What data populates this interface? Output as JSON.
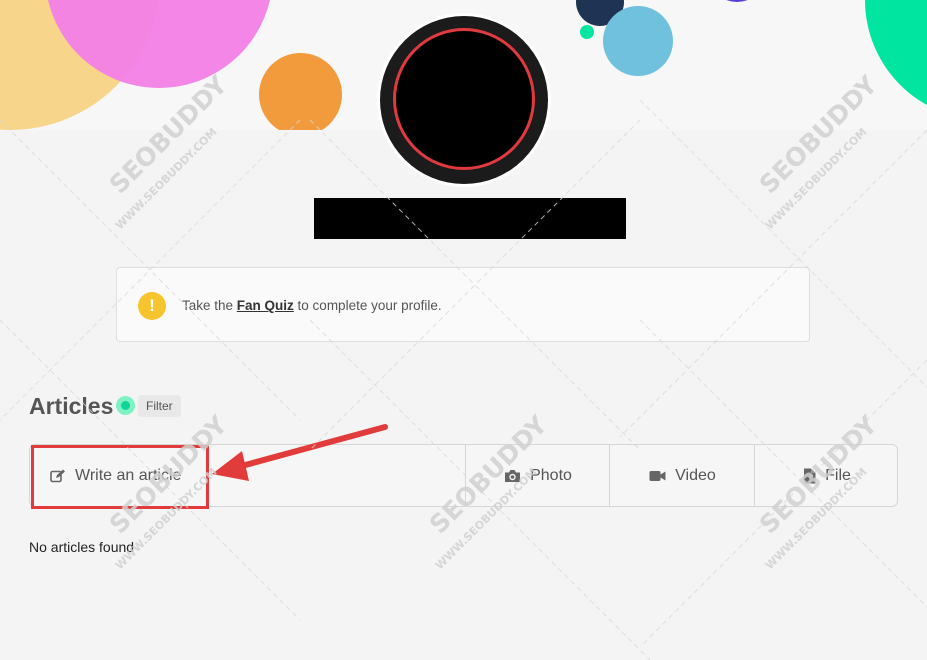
{
  "colors": {
    "background": "#f4f4f4",
    "banner_pink": "#f37fe6",
    "banner_yellow": "#f7d58a",
    "banner_orange": "#f29b3c",
    "banner_blue": "#6fc1de",
    "banner_navy": "#1f3354",
    "banner_green": "#00e5a0",
    "avatar_ring": "#e0393e",
    "notice_icon": "#f6c42c",
    "annotation_red": "#e23b3b",
    "live_green": "#10d59a"
  },
  "notice": {
    "icon_text": "!",
    "prefix": "Take the ",
    "link": "Fan Quiz",
    "suffix": " to complete your profile."
  },
  "articles": {
    "title": "Articles",
    "filter": "Filter",
    "empty": "No articles found"
  },
  "composer": {
    "write": "Write an article",
    "photo": "Photo",
    "video": "Video",
    "file": "File"
  },
  "icons": {
    "write": "edit-icon",
    "photo": "camera-icon",
    "video": "video-camera-icon",
    "file": "file-icon",
    "notice": "exclamation-icon"
  },
  "watermark": {
    "brand": "SEOBUDDY",
    "url": "WWW.SEOBUDDY.COM"
  }
}
